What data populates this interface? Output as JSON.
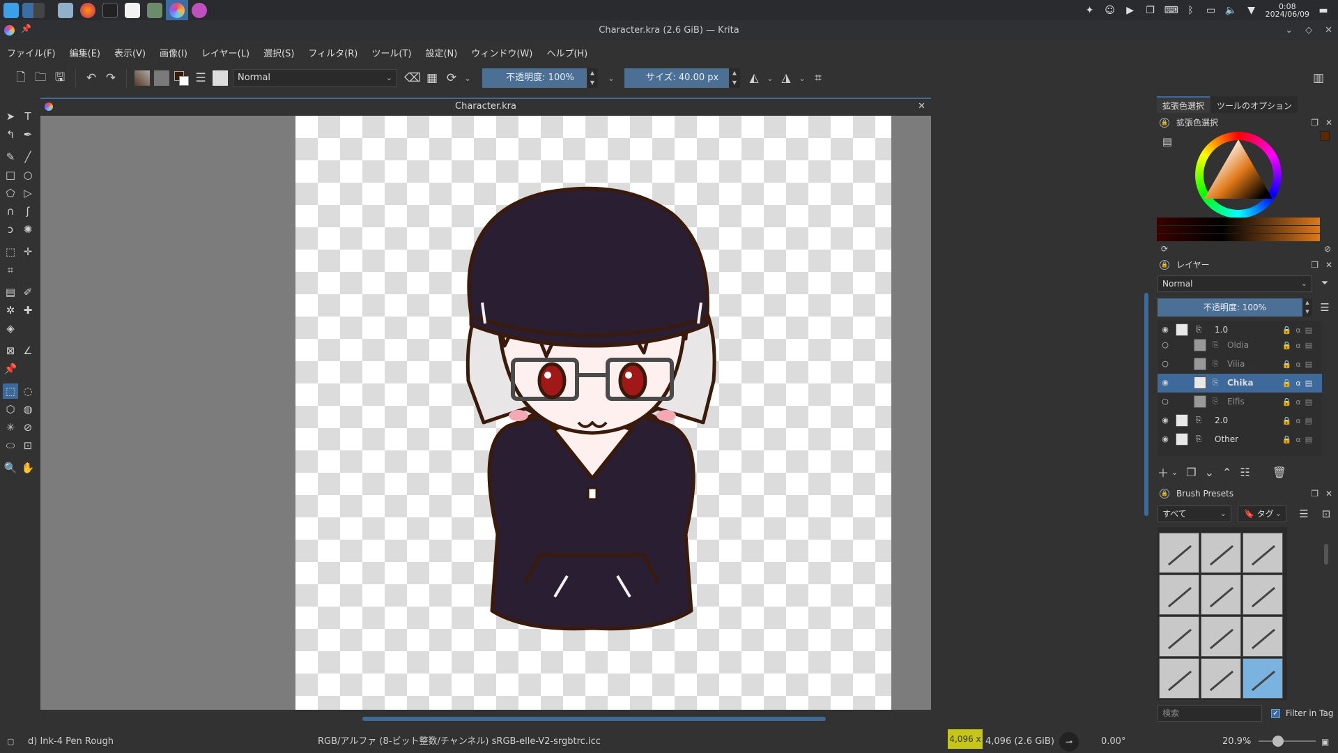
{
  "window": {
    "title": "Character.kra (2.6 GiB) — Krita",
    "controls": [
      "⌄",
      "◇",
      "✕"
    ]
  },
  "taskbar": {
    "clock_time": "0:08",
    "clock_date": "2024/06/09",
    "apps": [
      "app-launcher",
      "pager",
      "files",
      "firefox",
      "terminal",
      "document-viewer",
      "system-settings",
      "krita",
      "app"
    ]
  },
  "menu": [
    "ファイル(F)",
    "編集(E)",
    "表示(V)",
    "画像(I)",
    "レイヤー(L)",
    "選択(S)",
    "フィルタ(R)",
    "ツール(T)",
    "設定(N)",
    "ウィンドウ(W)",
    "ヘルプ(H)"
  ],
  "tool_options": {
    "blend_mode": "Normal",
    "opacity": "不透明度: 100%",
    "size": "サイズ: 40.00 px"
  },
  "document": {
    "tab_title": "Character.kra"
  },
  "dock": {
    "tabs": [
      "拡張色選択",
      "ツールのオプション"
    ],
    "color_panel_title": "拡張色選択",
    "layers_panel_title": "レイヤー",
    "layer_blend_mode": "Normal",
    "layer_opacity": "不透明度: 100%",
    "layers": [
      {
        "name": "1.0",
        "visible": true,
        "selected": false,
        "dim": false
      },
      {
        "name": "Oldia",
        "visible": false,
        "selected": false,
        "dim": true
      },
      {
        "name": "Vilia",
        "visible": false,
        "selected": false,
        "dim": true
      },
      {
        "name": "Chika",
        "visible": true,
        "selected": true,
        "dim": false
      },
      {
        "name": "Elfis",
        "visible": false,
        "selected": false,
        "dim": true
      },
      {
        "name": "2.0",
        "visible": true,
        "selected": false,
        "dim": false
      },
      {
        "name": "Other",
        "visible": true,
        "selected": false,
        "dim": false
      }
    ],
    "brush_panel_title": "Brush Presets",
    "brush_filter": "すべて",
    "brush_tag": "タグ",
    "brush_search_placeholder": "検索",
    "filter_in_tag": "Filter in Tag"
  },
  "status": {
    "brush_name": "d) Ink-4 Pen Rough",
    "color_space": "RGB/アルファ (8-ビット整数/チャンネル)  sRGB-elle-V2-srgbtrc.icc",
    "image_size_badge": "4,096 x",
    "image_size": "4,096 (2.6 GiB)",
    "rotation": "0.00°",
    "zoom": "20.9%"
  },
  "colors": {
    "accent": "#3d6a9b",
    "hair": "#e8e6e6",
    "outline": "#3a1a0a",
    "hoodie": "#2a1e33",
    "skin": "#fff0f0"
  }
}
